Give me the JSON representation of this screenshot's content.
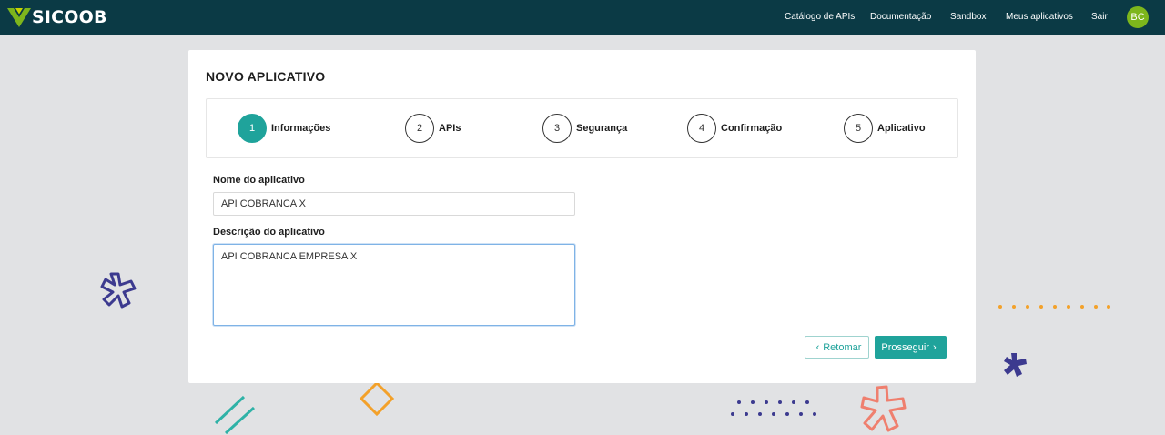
{
  "header": {
    "logo_text": "SICOOB",
    "nav": [
      "Catálogo de APIs",
      "Documentação",
      "Sandbox",
      "Meus aplicativos",
      "Sair"
    ],
    "avatar_initials": "BC",
    "colors": {
      "bar": "#0b3a45",
      "logo_mark": "#7db61c",
      "avatar": "#7db61c"
    }
  },
  "page": {
    "title": "NOVO APLICATIVO"
  },
  "stepper": {
    "active_step": 1,
    "steps": [
      {
        "number": "1",
        "label": "Informações"
      },
      {
        "number": "2",
        "label": "APIs"
      },
      {
        "number": "3",
        "label": "Segurança"
      },
      {
        "number": "4",
        "label": "Confirmação"
      },
      {
        "number": "5",
        "label": "Aplicativo"
      }
    ],
    "active_color": "#1fa39b"
  },
  "form": {
    "name_label": "Nome do aplicativo",
    "name_value": "API COBRANCA X",
    "description_label": "Descrição do aplicativo",
    "description_value": "API COBRANCA EMPRESA X"
  },
  "actions": {
    "back_label": "Retomar",
    "back_icon": "chevron-left-icon",
    "next_label": "Prosseguir",
    "next_icon": "chevron-right-icon"
  }
}
